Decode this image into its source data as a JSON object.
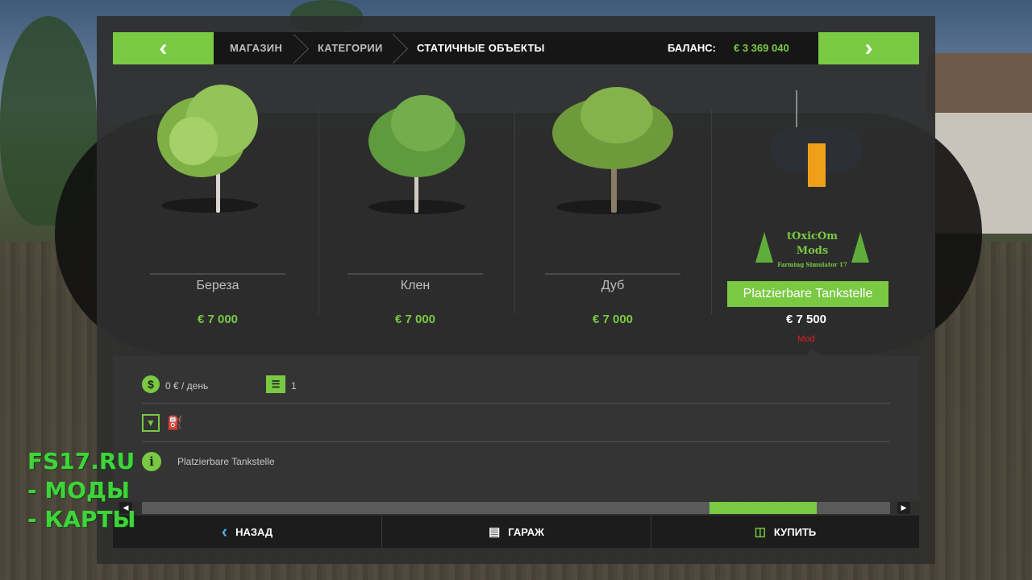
{
  "header": {
    "breadcrumbs": [
      "МАГАЗИН",
      "КАТЕГОРИИ",
      "СТАТИЧНЫЕ ОБЪЕКТЫ"
    ],
    "balance_label": "БАЛАНС:",
    "balance_value": "€ 3 369 040"
  },
  "items": [
    {
      "name": "Береза",
      "price": "€ 7 000"
    },
    {
      "name": "Клен",
      "price": "€ 7 000"
    },
    {
      "name": "Дуб",
      "price": "€ 7 000"
    },
    {
      "name": "Platzierbare Tankstelle",
      "price": "€ 7 500",
      "tag": "Mod",
      "selected": true
    }
  ],
  "mod_logo": {
    "line1": "tOxicOm",
    "line2": "Mods",
    "line3": "Farming Simulator 17"
  },
  "details": {
    "upkeep": "0 € / день",
    "storage_count": "1",
    "description": "Platzierbare Tankstelle"
  },
  "scrollbar": {
    "position_fraction": 0.86
  },
  "footer": {
    "back": "НАЗАД",
    "garage": "ГАРАЖ",
    "buy": "КУПИТЬ"
  },
  "watermark": {
    "line1": "FS17.RU",
    "line2": "- МОДЫ",
    "line3": "- КАРТЫ"
  },
  "colors": {
    "accent": "#7ac943",
    "mod_tag": "#e02020"
  }
}
